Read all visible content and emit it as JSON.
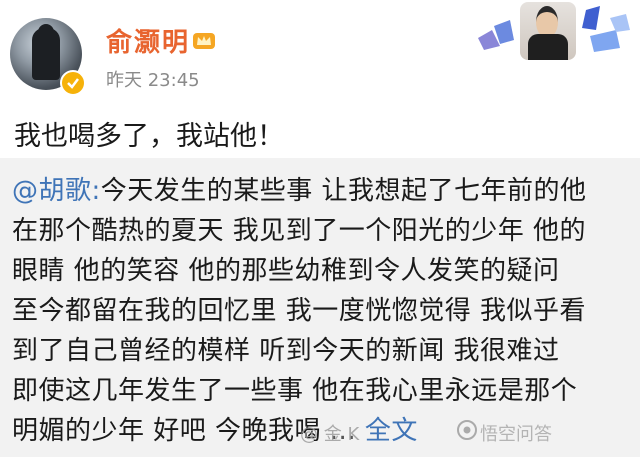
{
  "post": {
    "username": "俞灏明",
    "timestamp": "昨天 23:45",
    "text": "我也喝多了，我站他！"
  },
  "repost": {
    "mention": "@胡歌:",
    "lines": [
      "今天发生的某些事 让我想起了七年前的他",
      "在那个酷热的夏天 我见到了一个阳光的少年 他的",
      "眼睛 他的笑容 他的那些幼稚到令人发笑的疑问",
      "至今都留在我的回忆里 我一度恍惚觉得 我似乎看",
      "到了自己曾经的模样 听到今天的新闻 我很难过",
      "即使这几年发生了一些事 他在我心里永远是那个",
      "明媚的少年 好吧 今晚我喝"
    ],
    "ellipsis": "...",
    "full_text_link": "全文"
  },
  "watermark": {
    "weibo_handle": "@ 金 K",
    "source": "悟空问答"
  },
  "colors": {
    "username": "#e8642f",
    "link": "#3f74b7",
    "repost_bg": "#f2f2f2",
    "badge": "#f6b20a"
  },
  "icons": {
    "verified": "verified-badge-icon",
    "crown": "crown-icon",
    "eye": "wukong-eye-icon"
  }
}
